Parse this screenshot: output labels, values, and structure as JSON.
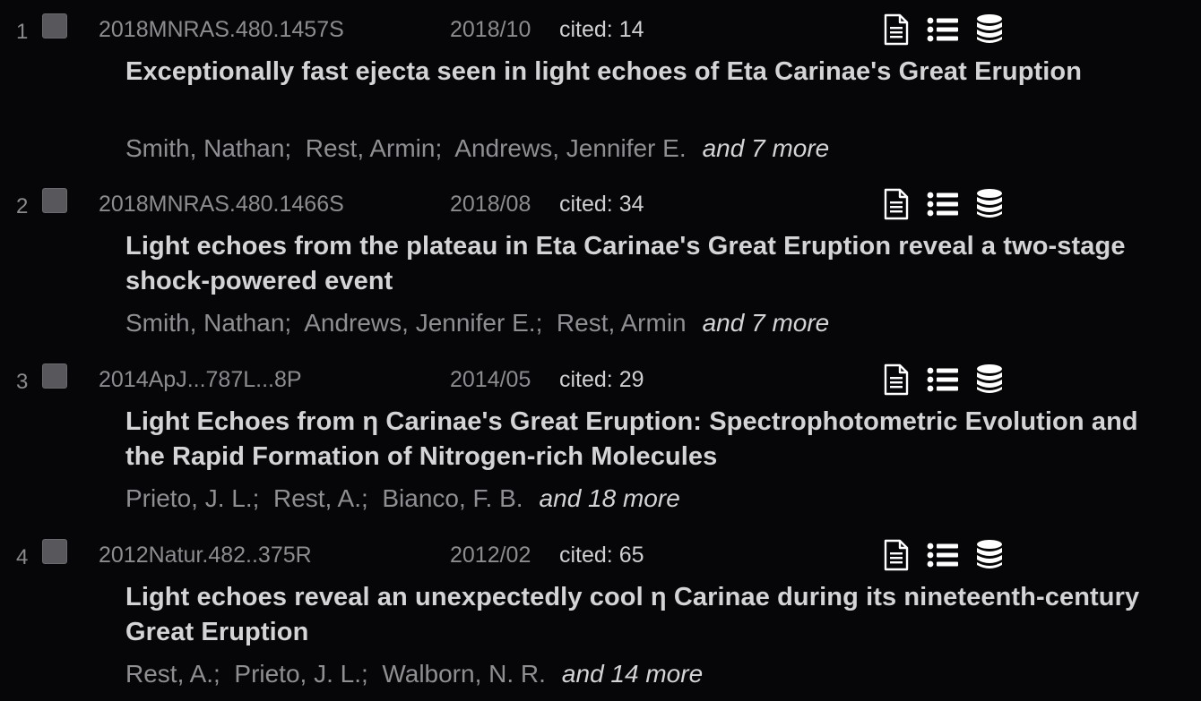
{
  "results": [
    {
      "index": "1",
      "bibcode": "2018MNRAS.480.1457S",
      "date": "2018/10",
      "cited": "cited: 14",
      "title": "Exceptionally fast ejecta seen in light echoes of Eta Carinae's Great Eruption",
      "authors": [
        "Smith, Nathan;",
        "Rest, Armin;",
        "Andrews, Jennifer E."
      ],
      "more": "and 7 more"
    },
    {
      "index": "2",
      "bibcode": "2018MNRAS.480.1466S",
      "date": "2018/08",
      "cited": "cited: 34",
      "title": "Light echoes from the plateau in Eta Carinae's Great Eruption reveal a two-stage shock-powered event",
      "authors": [
        "Smith, Nathan;",
        "Andrews, Jennifer E.;",
        "Rest, Armin"
      ],
      "more": "and 7 more"
    },
    {
      "index": "3",
      "bibcode": "2014ApJ...787L...8P",
      "date": "2014/05",
      "cited": "cited: 29",
      "title": "Light Echoes from η Carinae's Great Eruption: Spectrophotometric Evolution and the Rapid Formation of Nitrogen-rich Molecules",
      "authors": [
        "Prieto, J. L.;",
        "Rest, A.;",
        "Bianco, F. B."
      ],
      "more": "and 18 more"
    },
    {
      "index": "4",
      "bibcode": "2012Natur.482..375R",
      "date": "2012/02",
      "cited": "cited: 65",
      "title": "Light echoes reveal an unexpectedly cool η Carinae during its nineteenth-century Great Eruption",
      "authors": [
        "Rest, A.;",
        "Prieto, J. L.;",
        "Walborn, N. R."
      ],
      "more": "and 14 more"
    }
  ],
  "icons": [
    "full-text-sources-icon",
    "references-list-icon",
    "data-products-icon"
  ],
  "colors": {
    "background": "#060608",
    "title": "#d4d4d7",
    "muted": "#8c8c90",
    "checkbox": "#58585c"
  }
}
